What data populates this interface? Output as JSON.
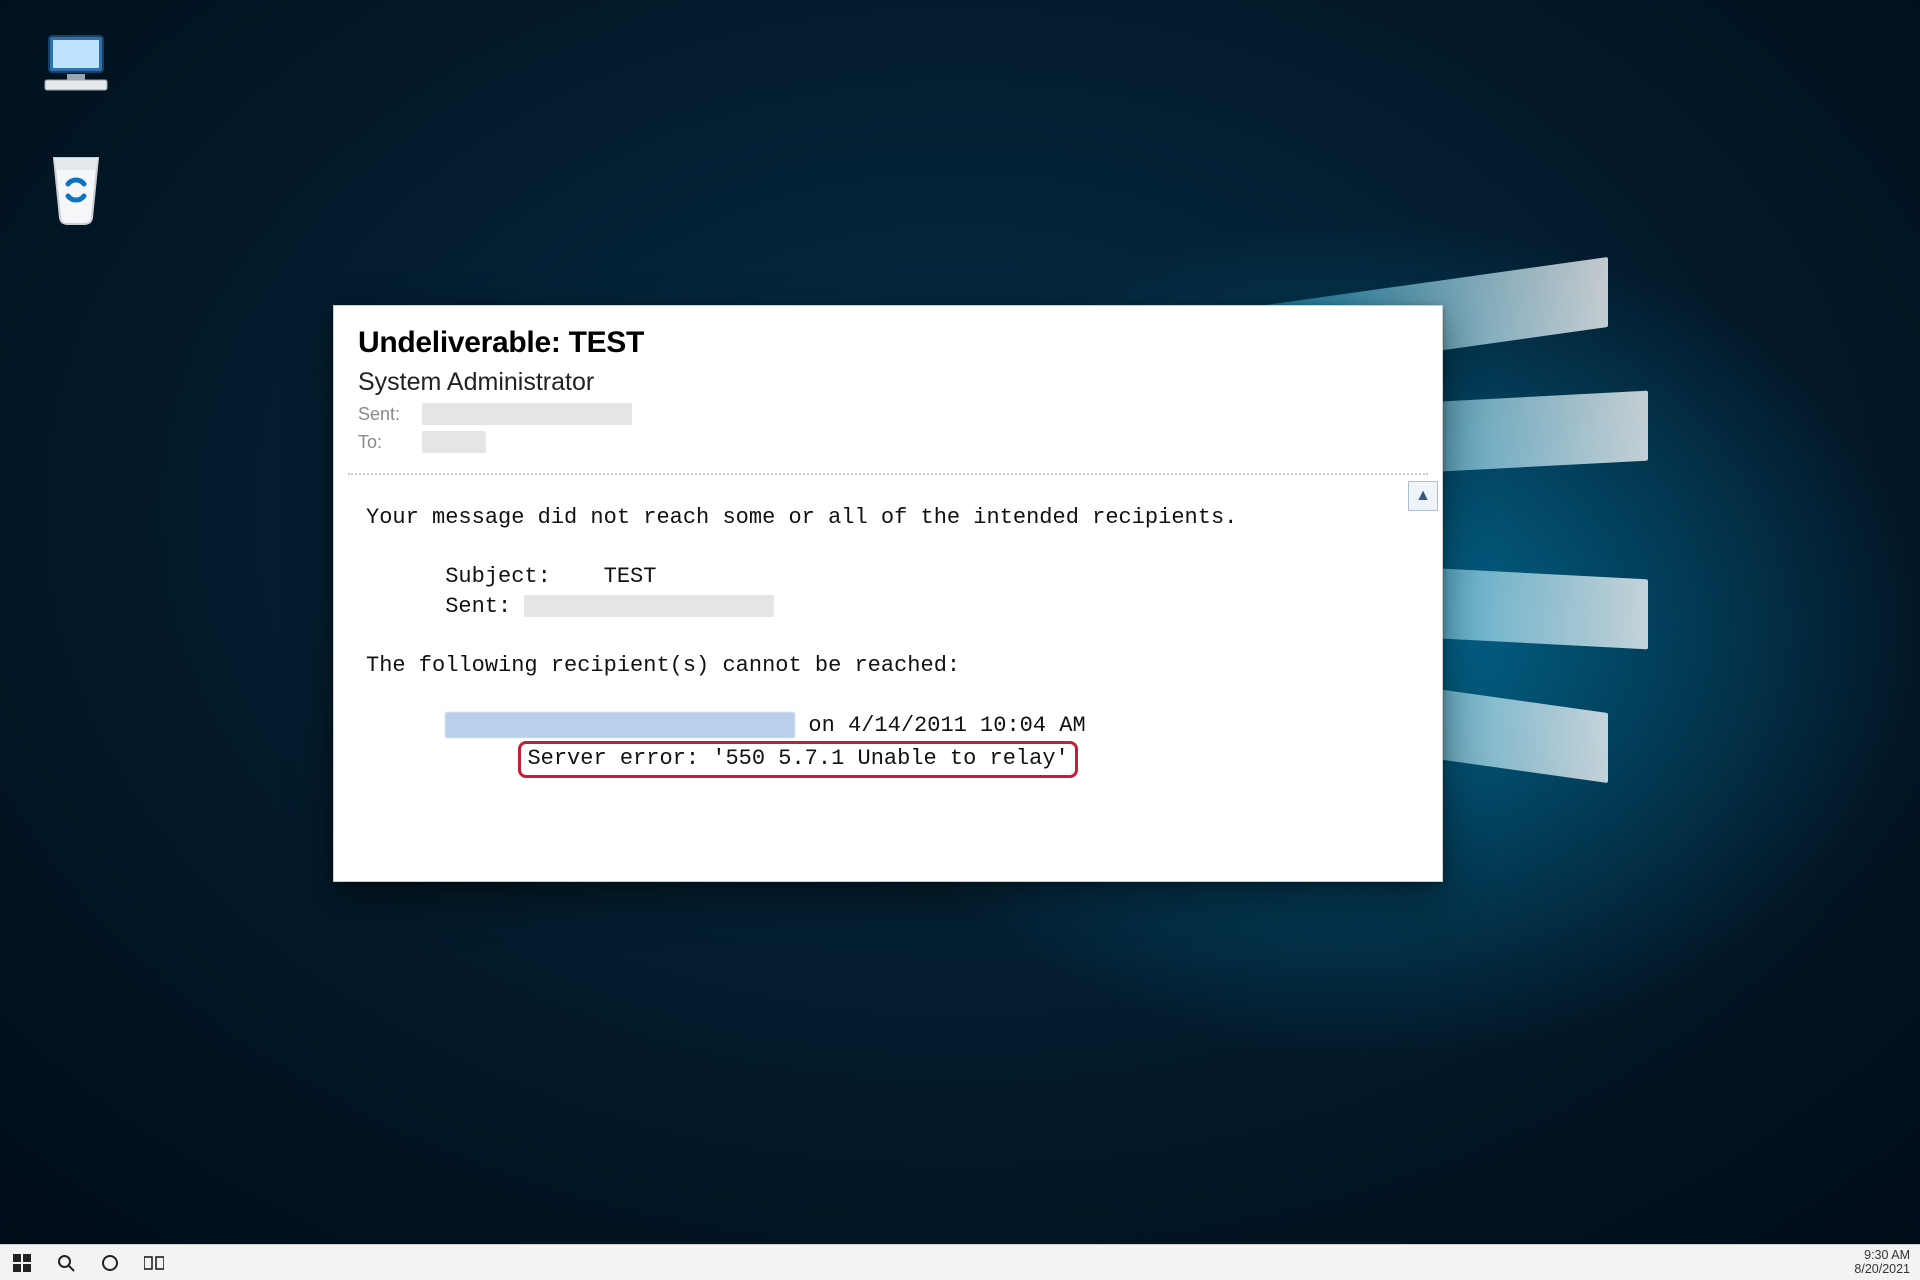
{
  "desktop": {
    "icons": {
      "this_pc": "This PC",
      "recycle_bin": "Recycle Bin"
    }
  },
  "email": {
    "subject": "Undeliverable: TEST",
    "from": "System Administrator",
    "meta": {
      "sent_label": "Sent:",
      "to_label": "To:"
    },
    "body": {
      "line1": "Your message did not reach some or all of the intended recipients.",
      "subject_label": "Subject:",
      "subject_value": "TEST",
      "sent_label": "Sent:",
      "line3": "The following recipient(s) cannot be reached:",
      "recipient_suffix": " on 4/14/2011 10:04 AM",
      "error_line": "Server error: '550 5.7.1 Unable to relay'"
    }
  },
  "taskbar": {
    "time": "9:30 AM",
    "date": "8/20/2021"
  }
}
